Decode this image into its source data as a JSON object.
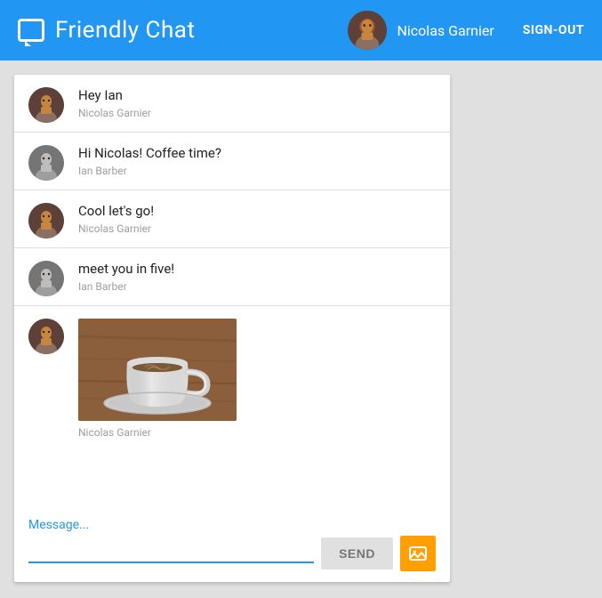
{
  "header": {
    "logo_label": "Friendly Chat",
    "username": "Nicolas Garnier",
    "signout_label": "SIGN-OUT"
  },
  "chat": {
    "messages": [
      {
        "id": 1,
        "text": "Hey Ian",
        "author": "Nicolas Garnier",
        "avatar_type": "nicolas",
        "type": "text"
      },
      {
        "id": 2,
        "text": "Hi Nicolas! Coffee time?",
        "author": "Ian Barber",
        "avatar_type": "ian",
        "type": "text"
      },
      {
        "id": 3,
        "text": "Cool let's go!",
        "author": "Nicolas Garnier",
        "avatar_type": "nicolas",
        "type": "text"
      },
      {
        "id": 4,
        "text": "meet you in five!",
        "author": "Ian Barber",
        "avatar_type": "ian",
        "type": "text"
      },
      {
        "id": 5,
        "text": "",
        "author": "Nicolas Garnier",
        "avatar_type": "nicolas",
        "type": "image"
      }
    ],
    "input_placeholder": "Message...",
    "send_label": "SEND"
  }
}
